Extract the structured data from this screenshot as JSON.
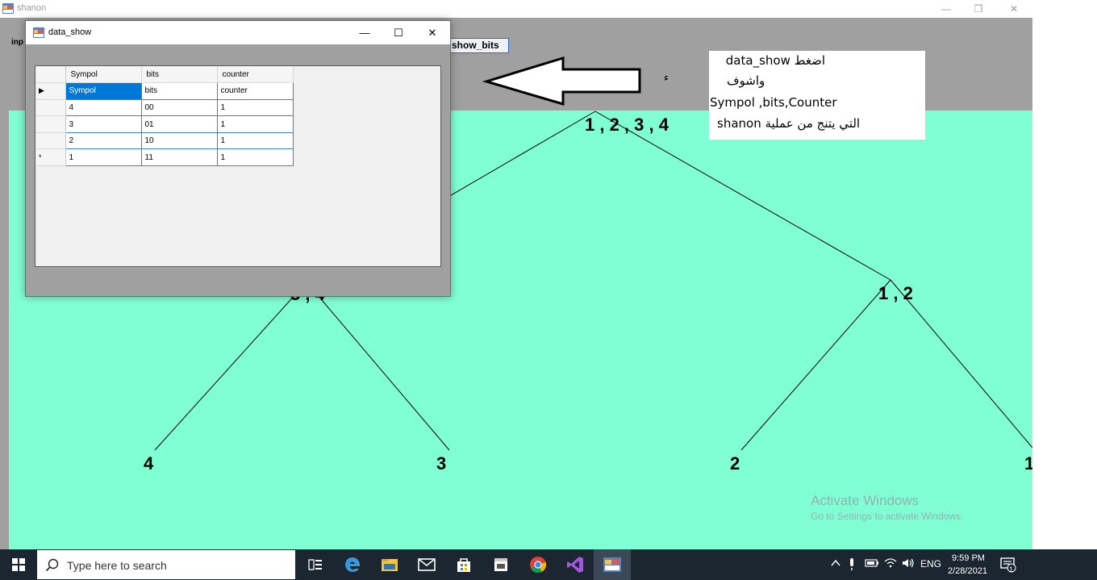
{
  "main_window": {
    "title": "shanon",
    "minimize_glyph": "—",
    "restore_glyph": "❐",
    "close_glyph": "✕",
    "input_label_partial": "inp",
    "show_bits_button": "show_bits"
  },
  "tree": {
    "root": "1 , 2 , 3 , 4",
    "left_child_partial": "3 , 4",
    "right_child": "1 , 2",
    "leaf_4": "4",
    "leaf_3": "3",
    "leaf_2": "2",
    "leaf_1_partial": "1"
  },
  "note": {
    "line1": "اضغط data_show",
    "line2": "واشوف",
    "line3": "Sympol ,bits,Counter",
    "line4": "التي يتنج من عملية shanon",
    "stray_mark": "ء"
  },
  "data_show_window": {
    "title": "data_show",
    "minimize_glyph": "—",
    "maximize_glyph": "☐",
    "close_glyph": "✕",
    "columns": [
      "Sympol",
      "bits",
      "counter"
    ],
    "rows": [
      {
        "marker": "▶",
        "cells": [
          "Sympol",
          "bits",
          "counter"
        ]
      },
      {
        "marker": "",
        "cells": [
          "4",
          "00",
          "1"
        ]
      },
      {
        "marker": "",
        "cells": [
          "3",
          "01",
          "1"
        ]
      },
      {
        "marker": "",
        "cells": [
          "2",
          "10",
          "1"
        ]
      },
      {
        "marker": "*",
        "cells": [
          "1",
          "11",
          "1"
        ]
      }
    ]
  },
  "watermark": {
    "title": "Activate Windows",
    "subtitle": "Go to Settings to activate Windows."
  },
  "taskbar": {
    "search_placeholder": "Type here to search",
    "language": "ENG",
    "time": "9:59 PM",
    "date": "2/28/2021",
    "notification_count": "1",
    "icons": [
      "task-view-icon",
      "edge-icon",
      "file-explorer-icon",
      "mail-icon",
      "store-icon",
      "video-editor-icon",
      "chrome-icon",
      "visual-studio-icon",
      "running-app-icon"
    ]
  }
}
